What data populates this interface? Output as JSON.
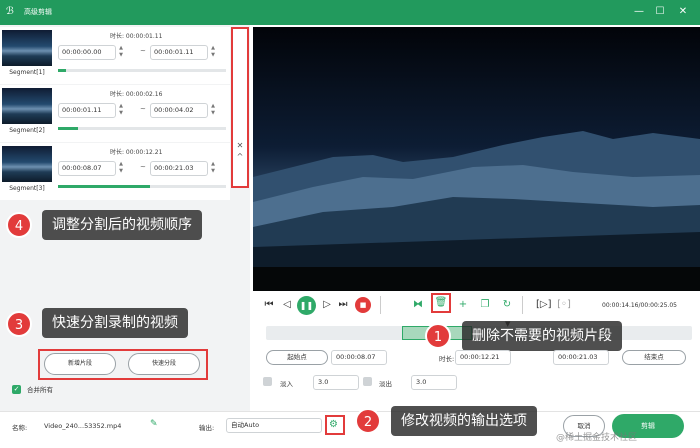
{
  "window": {
    "title": "高级剪辑",
    "logo_glyph": "ℬ",
    "minimize": "—",
    "maximize": "☐",
    "close": "✕"
  },
  "segments": [
    {
      "label": "Segment[1]",
      "duration_label": "时长: 00:00:01.11",
      "start": "00:00:00.00",
      "end": "00:00:01.11",
      "progress": 0.05
    },
    {
      "label": "Segment[2]",
      "duration_label": "时长: 00:00:02.16",
      "start": "00:00:01.11",
      "end": "00:00:04.02",
      "progress": 0.12
    },
    {
      "label": "Segment[3]",
      "duration_label": "时长: 00:00:12.21",
      "start": "00:00:08.07",
      "end": "00:00:21.03",
      "progress": 0.55
    }
  ],
  "sort_controls": {
    "close": "✕",
    "up": "^"
  },
  "callouts": [
    {
      "num": "4",
      "text": "调整分割后的视频顺序"
    },
    {
      "num": "3",
      "text": "快速分割录制的视频"
    },
    {
      "num": "1",
      "text": "删除不需要的视频片段"
    },
    {
      "num": "2",
      "text": "修改视频的输出选项"
    }
  ],
  "left_actions": {
    "new_segment": "新增片段",
    "quick_split": "快速分段",
    "merge_all": "合并所有"
  },
  "player": {
    "time_display": "00:00:14.16/00:00:25.05",
    "timeline_progress": 0.58,
    "start_point_label": "起始点",
    "start_value": "00:00:08.07",
    "duration_label": "时长:",
    "duration_value": "00:00:12.21",
    "end_value": "00:00:21.03",
    "end_point_label": "结束点",
    "fade_in_label": "淡入",
    "fade_in_value": "3.0",
    "fade_out_label": "淡出",
    "fade_out_value": "3.0"
  },
  "bottom": {
    "name_label": "名称:",
    "filename": "Video_240...53352.mp4",
    "output_label": "输出:",
    "output_value": "自动Auto",
    "cancel_label": "取消",
    "edit_label": "剪辑"
  },
  "watermark": "@稀土掘金技术社区",
  "colors": {
    "brand": "#229a5d",
    "accent_red": "#e23b3b",
    "callout_bg": "#2d2d2d"
  }
}
